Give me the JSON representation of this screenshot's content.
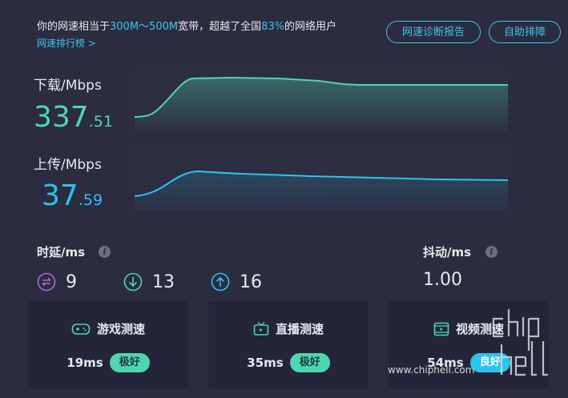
{
  "summary": {
    "prefix": "你的网速相当于",
    "bandwidth": "300M～500M",
    "middle": "宽带，超越了全国",
    "percent": "83%",
    "suffix": "的网络用户"
  },
  "rank_link": "网速排行榜 >",
  "buttons": {
    "report": "网速诊断报告",
    "self_fix": "自助排障"
  },
  "download": {
    "label": "下载/Mbps",
    "int": "337",
    "dec": ".51"
  },
  "upload": {
    "label": "上传/Mbps",
    "int": "37",
    "dec": ".59"
  },
  "latency": {
    "label": "时延/ms",
    "items": [
      {
        "icon": "bidirectional-arrows-icon",
        "value": "9",
        "color": "#b06bd8"
      },
      {
        "icon": "down-arrow-circle-icon",
        "value": "13",
        "color": "#4ed6b2"
      },
      {
        "icon": "up-arrow-circle-icon",
        "value": "16",
        "color": "#2ac4ee"
      }
    ]
  },
  "jitter": {
    "label": "抖动/ms",
    "value": "1.00"
  },
  "cards": [
    {
      "icon": "gamepad-icon",
      "title": "游戏测速",
      "ms": "19ms",
      "badge": "极好",
      "badge_style": "green"
    },
    {
      "icon": "tv-icon",
      "title": "直播测速",
      "ms": "35ms",
      "badge": "极好",
      "badge_style": "green"
    },
    {
      "icon": "video-icon",
      "title": "视频测速",
      "ms": "54ms",
      "badge": "良好",
      "badge_style": "blue"
    }
  ],
  "watermark": {
    "logo": "chip hell",
    "url": "www.chiphell.com"
  },
  "colors": {
    "download": "#4ed6b2",
    "upload": "#2ac4ee",
    "accent": "#3fc6e6",
    "background": "#2b2c40"
  }
}
